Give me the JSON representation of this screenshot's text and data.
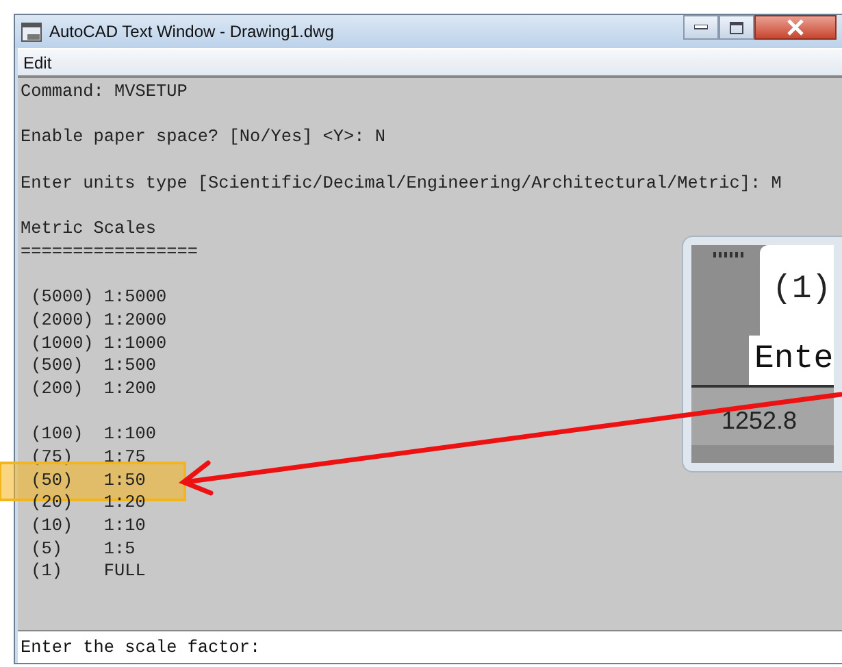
{
  "window": {
    "title": "AutoCAD Text Window - Drawing1.dwg"
  },
  "menu": [
    "Edit"
  ],
  "blocks": [
    {
      "lines": [
        {
          "text": "Command: MVSETUP",
          "selected": false
        }
      ]
    },
    {
      "lines": [
        {
          "text": "Enable paper space? [No/Yes] <Y>: N",
          "selected": false
        }
      ]
    },
    {
      "lines": [
        {
          "text": "Enter units type [Scientific/Decimal/Engineering/Architectural/Metric]: M",
          "selected": false
        }
      ]
    },
    {
      "lines": [
        {
          "text": "Metric Scales",
          "selected": false
        },
        {
          "text": "=================",
          "selected": false
        }
      ]
    },
    {
      "lines": [
        {
          "text": " (5000) 1:5000",
          "selected": false
        },
        {
          "text": " (2000) 1:2000",
          "selected": false
        },
        {
          "text": " (1000) 1:1000",
          "selected": false
        },
        {
          "text": " (500)  1:500",
          "selected": false
        },
        {
          "text": " (200)  1:200",
          "selected": false
        }
      ]
    },
    {
      "lines": [
        {
          "text": " (100)  1:100",
          "selected": false
        },
        {
          "text": " (75)   1:75",
          "selected": false
        },
        {
          "text": " (50)   1:50",
          "selected": true
        },
        {
          "text": " (20)   1:20",
          "selected": false
        },
        {
          "text": " (10)   1:10",
          "selected": false
        },
        {
          "text": " (5)    1:5",
          "selected": false
        },
        {
          "text": " (1)    FULL",
          "selected": false
        }
      ]
    }
  ],
  "command_line": {
    "value": "Enter the scale factor:"
  },
  "inset": {
    "top_text": "(1)",
    "middle_text": "Ente",
    "bottom_text": "1252.8"
  }
}
